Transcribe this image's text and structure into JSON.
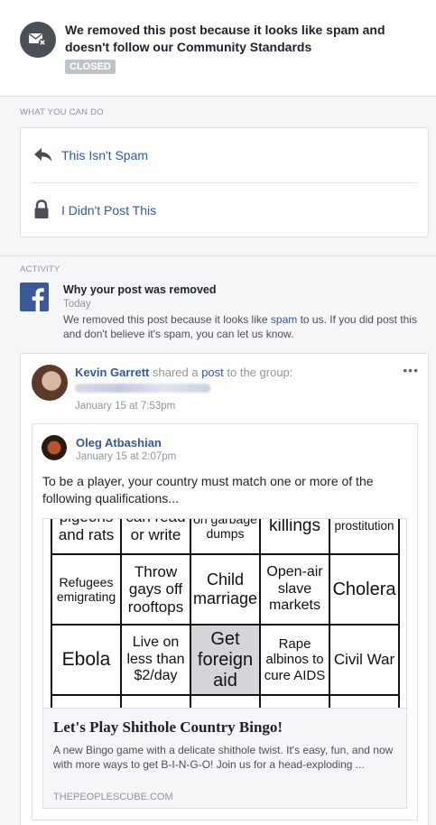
{
  "notice": {
    "title": "We removed this post because it looks like spam and doesn't follow our Community Standards",
    "status": "CLOSED"
  },
  "what_you_can_do": {
    "label": "WHAT YOU CAN DO",
    "actions": [
      {
        "label": "This Isn't Spam",
        "icon": "reply-arrow-icon"
      },
      {
        "label": "I Didn't Post This",
        "icon": "lock-icon"
      }
    ]
  },
  "activity": {
    "label": "ACTIVITY",
    "title": "Why your post was removed",
    "date": "Today",
    "text_before": "We removed this post because it looks like ",
    "text_link": "spam",
    "text_after": " to us. If you did post this and don't believe it's spam, you can let us know."
  },
  "post": {
    "author": "Kevin Garrett",
    "shared_text": " shared a ",
    "post_link": "post",
    "group_text": " to the group:",
    "date": "January 15 at 7:53pm",
    "shared": {
      "author": "Oleg Atbashian",
      "date": "January 15 at 2:07pm",
      "text": "To be a player, your country must match one or more of the following qualifications...",
      "bingo_cells": [
        "pigeons and rats",
        "can read or write",
        "on garbage dumps",
        "killings",
        "prostitution",
        "Refugees emigrating",
        "Throw gays off rooftops",
        "Child marriage",
        "Open-air slave markets",
        "Cholera",
        "Ebola",
        "Live on less than $2/day",
        "Get foreign aid",
        "Rape albinos to cure AIDS",
        "Civil War",
        "",
        "",
        "",
        "",
        ""
      ],
      "link_title": "Let's Play Shithole Country Bingo!",
      "link_desc": "A new Bingo game with a delicate shithole twist. It's easy, fun, and now with more ways to get B-I-N-G-O! Join us for a head-exploding ...",
      "link_domain": "THEPEOPLESCUBE.COM"
    }
  },
  "colors": {
    "link": "#365899",
    "muted": "#90949c",
    "fb_blue": "#3b5998"
  }
}
